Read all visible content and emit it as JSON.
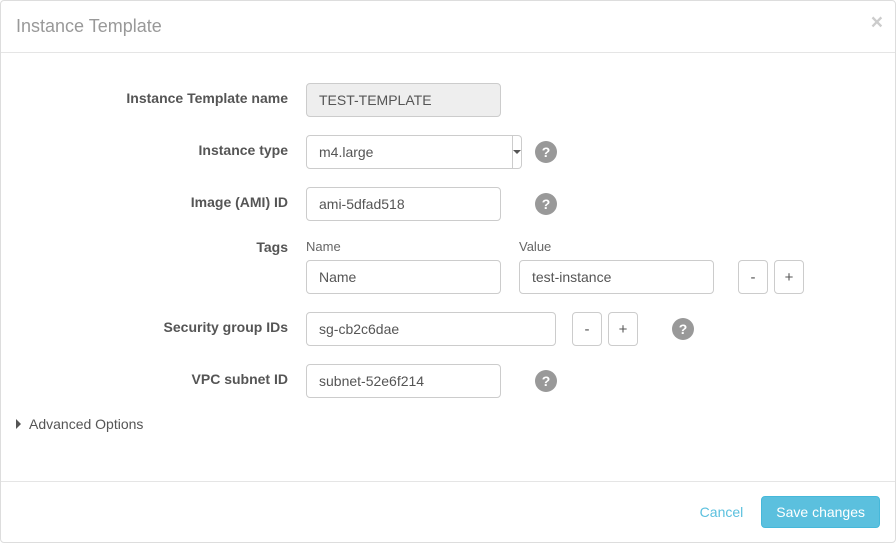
{
  "modal": {
    "title": "Instance Template",
    "close": "×"
  },
  "labels": {
    "template_name": "Instance Template name",
    "instance_type": "Instance type",
    "image_ami": "Image (AMI) ID",
    "tags": "Tags",
    "security_groups": "Security group IDs",
    "vpc_subnet": "VPC subnet ID",
    "advanced": "Advanced Options"
  },
  "tag_headers": {
    "name": "Name",
    "value": "Value"
  },
  "values": {
    "template_name": "TEST-TEMPLATE",
    "instance_type": "m4.large",
    "image_ami": "ami-5dfad518",
    "tag_name": "Name",
    "tag_value": "test-instance",
    "security_group": "sg-cb2c6dae",
    "vpc_subnet": "subnet-52e6f214"
  },
  "buttons": {
    "remove": "-",
    "add": "+",
    "help": "?",
    "cancel": "Cancel",
    "save": "Save changes"
  }
}
